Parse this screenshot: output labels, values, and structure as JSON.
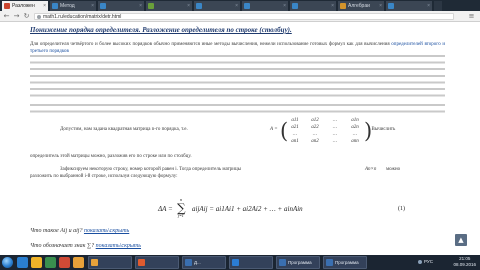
{
  "browser": {
    "tabs": [
      {
        "label": "Разложен",
        "active": true,
        "color": "#c8442f"
      },
      {
        "label": "Метод",
        "active": false,
        "color": "#3a86c6"
      },
      {
        "label": "",
        "active": false,
        "color": "#3a86c6"
      },
      {
        "label": "",
        "active": false,
        "color": "#6a9f3a"
      },
      {
        "label": "",
        "active": false,
        "color": "#3a86c6"
      },
      {
        "label": "",
        "active": false,
        "color": "#3a86c6"
      },
      {
        "label": "",
        "active": false,
        "color": "#3a86c6"
      },
      {
        "label": "Алгебраи",
        "active": false,
        "color": "#d2942c"
      },
      {
        "label": "",
        "active": false,
        "color": "#3a86c6"
      }
    ],
    "url": "math1.ru/education/matrix/detr.html"
  },
  "page": {
    "heading": "Понижение порядка определителя. Разложение определителя по строке (столбцу).",
    "para1": {
      "text": "Для определителя четвёртого и более высоких порядков обычно применяются иные методы вычисления, нежели использование готовых формул как для вычисления",
      "link": "определителей второго и третьего порядков"
    },
    "para2": {
      "lead": "Допустим, нам задана квадратная матрица n-го порядка, т.е.",
      "lhs": "A =",
      "tail": ". Вычислить",
      "continuation": "определитель этой матрицы можно, разложив его по строке или по столбцу."
    },
    "matrix": {
      "rows": [
        [
          "a11",
          "a12",
          "…",
          "a1n"
        ],
        [
          "a21",
          "a22",
          "…",
          "a2n"
        ],
        [
          "…",
          "…",
          "…",
          "…"
        ],
        [
          "an1",
          "an2",
          "…",
          "ann"
        ]
      ]
    },
    "para3": {
      "line1": "Зафиксируем некоторую строку, номер которой равен i. Тогда определитель матрицы",
      "matrix_symbol": "An×n",
      "line1_end": "можно",
      "line2": "разложить по выбранной i-й строке, используя следующую формулу:"
    },
    "formula": {
      "lhs": "ΔA =",
      "sum_top": "n",
      "sum_bottom": "j=1",
      "rhs": "aijAij = ai1Ai1 + ai2Ai2 + … + ainAin",
      "number": "(1)"
    },
    "toggles": [
      {
        "question": "Что такое Aij и aij?",
        "action": "показать\\скрыть"
      },
      {
        "question": "Что обозначает знак ∑?",
        "action": "показать\\скрыть"
      }
    ]
  },
  "taskbar": {
    "pinned_colors": [
      "#2a7fd1",
      "#f0b429",
      "#3a8f4e",
      "#d04a36",
      "#e8a23a"
    ],
    "windows": [
      {
        "label": "",
        "color": "#e8a23a"
      },
      {
        "label": "",
        "color": "#e05b2f"
      },
      {
        "label": "Д...",
        "color": "#3a6fb0"
      },
      {
        "label": "",
        "color": "#2b7cd3"
      },
      {
        "label": "Программа",
        "color": "#3a6fb0"
      },
      {
        "label": "Программа",
        "color": "#3a6fb0"
      }
    ],
    "language": "РУС",
    "time": "21:05",
    "date": "08.09.2016"
  },
  "colors": {
    "heading": "#1f3a6e",
    "link": "#1a4fa0",
    "taskbar": "#1b2532",
    "tabstrip": "#1f2a36"
  }
}
